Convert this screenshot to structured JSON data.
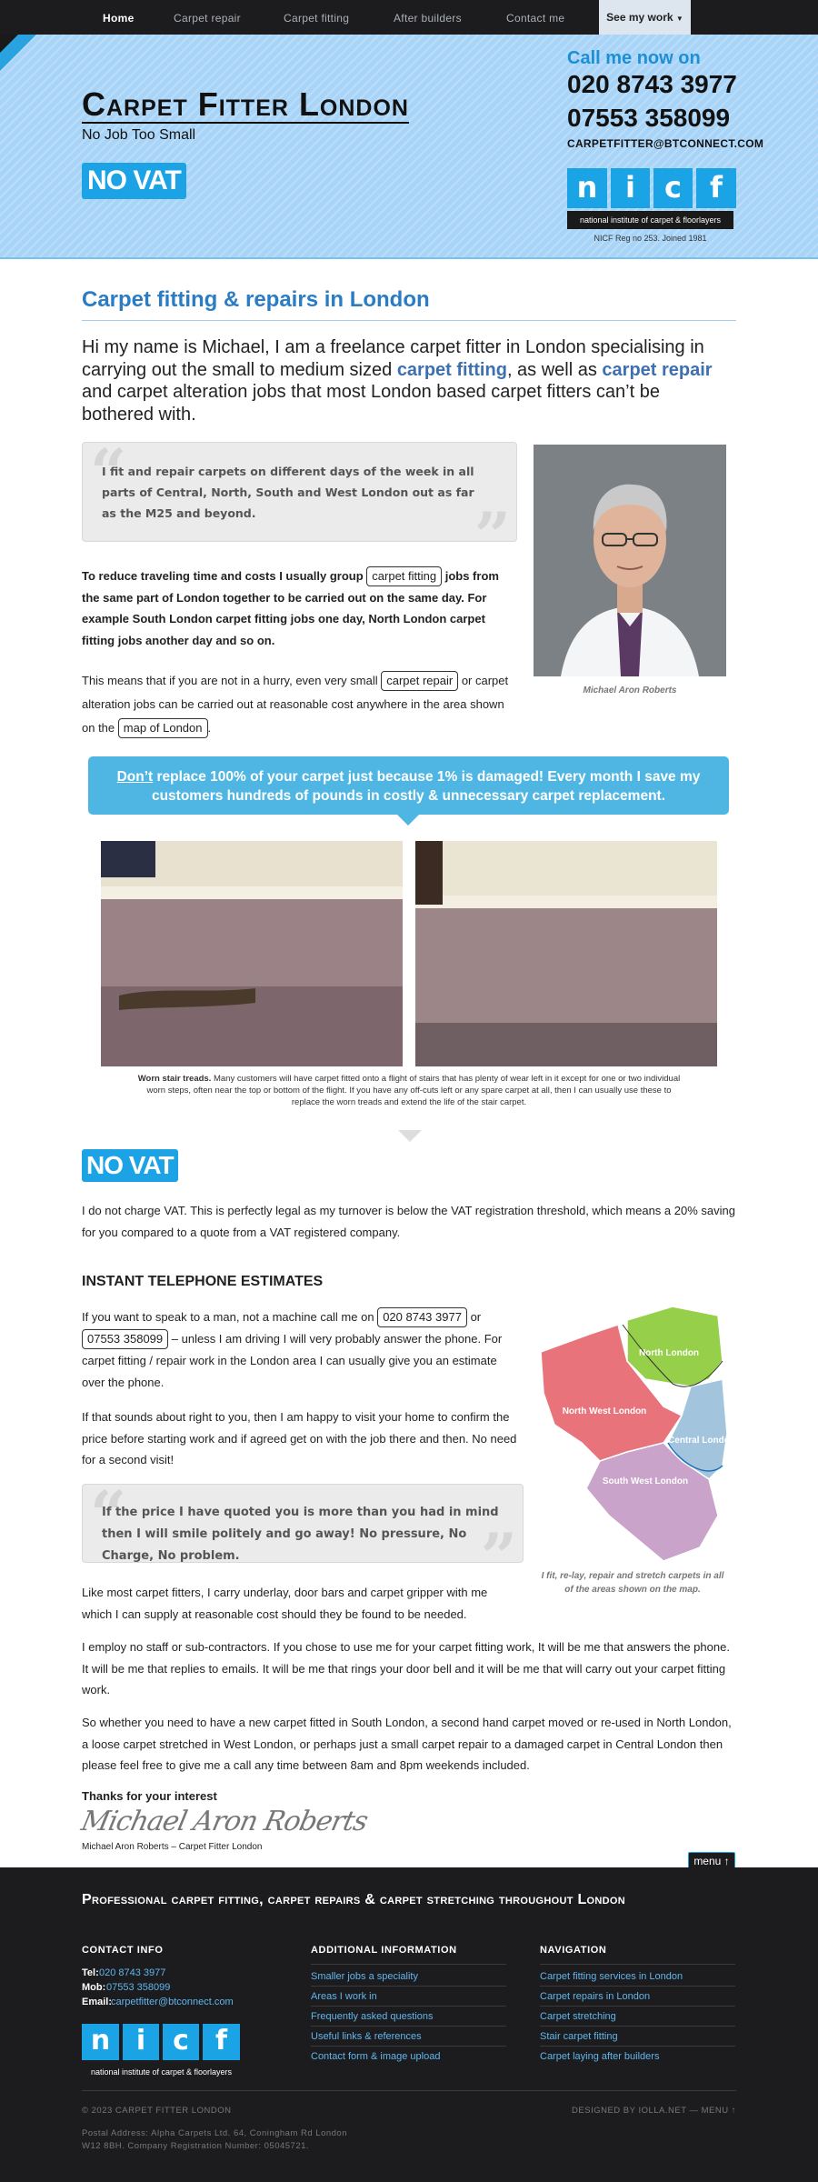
{
  "nav": {
    "items": [
      "Home",
      "Carpet repair",
      "Carpet fitting",
      "After builders",
      "Contact me"
    ],
    "see_work": "See my work"
  },
  "header": {
    "title": "Carpet Fitter London",
    "tagline": "No Job Too Small",
    "novat": "NO VAT",
    "call_now": "Call me now on",
    "phone1": "020 8743 3977",
    "phone2": "07553 358099",
    "email": "CARPETFITTER@BTCONNECT.COM",
    "nicf_letters": [
      "n",
      "i",
      "c",
      "f"
    ],
    "nicf_bar": "national institute of carpet & floorlayers",
    "nicf_reg": "NICF Reg no 253. Joined 1981"
  },
  "main": {
    "heading": "Carpet fitting & repairs in London",
    "intro_1": "Hi my name is Michael, I am a freelance carpet fitter in London specialising in carrying out the small to medium sized ",
    "intro_link1": "carpet fitting",
    "intro_2": ", as well as ",
    "intro_link2": "carpet repair",
    "intro_3": " and carpet alteration jobs that most London based carpet fitters can’t be bothered with.",
    "quote1": "I fit and repair carpets on different days of the week in all parts of Central, North, South and West London out as far as the M25 and beyond.",
    "para1_a": "To reduce traveling time and costs I usually group ",
    "para1_chip": "carpet fitting",
    "para1_b": " jobs from the same part of London together to be carried out on the same day. For example South London carpet fitting jobs one day, North London carpet fitting jobs another day and so on.",
    "para2_a": "This means that if you are not in a hurry, even very small ",
    "para2_chip1": "carpet repair",
    "para2_b": " or carpet alteration jobs can be carried out at reasonable cost anywhere in the area shown on the ",
    "para2_chip2": "map of London",
    "para2_c": ".",
    "portrait_caption": "Michael Aron Roberts",
    "banner_u": "Don’t",
    "banner_rest": " replace 100% of your carpet just because 1% is damaged! Every month I save my customers hundreds of pounds in costly & unnecessary carpet replacement.",
    "photo_caption_bold": "Worn stair treads.",
    "photo_caption": " Many customers will have carpet fitted onto a flight of stairs that has plenty of wear left in it except for one or two individual worn steps, often near the top or bottom of the flight. If you have any off-cuts left or any spare carpet at all, then I can usually use these to replace the worn treads and extend the life of the stair carpet.",
    "novat2": "NO VAT",
    "vat_text": "I do not charge VAT. This is perfectly legal as my turnover is below the VAT registration threshold, which means a 20% saving for you compared to a quote from a VAT registered company.",
    "estimates_heading": "INSTANT TELEPHONE ESTIMATES",
    "est1_a": "If you want to speak to a man, not a machine call me on ",
    "est1_chip1": "020 8743 3977",
    "est1_b": " or ",
    "est1_chip2": "07553 358099",
    "est1_c": " – unless I am driving I will very probably answer the phone. For carpet fitting / repair work in the London area I can usually give you an estimate over the phone.",
    "est2": "If that sounds about right to you, then I am happy to visit your home to confirm the price before starting work and if agreed get on with the job there and then. No need for a second visit!",
    "quote2": "If the price I have quoted you is more than you had in mind then I will smile politely and go away! No pressure, No Charge, No problem.",
    "map_regions": [
      "North London",
      "North West London",
      "Central London",
      "South West London"
    ],
    "map_caption": "I fit, re-lay, repair and stretch carpets in all of the areas shown on the map.",
    "p_underlay": "Like most carpet fitters, I carry underlay, door bars and carpet gripper with me which I can supply at reasonable cost should they be found to be needed.",
    "p_staff": "I employ no staff or sub-contractors. If you chose to use me for your carpet fitting work, It will be me that answers the phone. It will be me that replies to emails. It will be me that rings your door bell and it will be me that will carry out your carpet fitting work.",
    "p_whether": "So whether you need to have a new carpet fitted in South London, a second hand carpet moved or re-used in North London, a loose carpet stretched in West London, or perhaps just a small carpet repair to a damaged carpet in Central London then please feel free to give me a call any time between 8am and 8pm weekends included.",
    "thanks": "Thanks for your interest",
    "signature": "Michael Aron Roberts",
    "sig_caption": "Michael Aron Roberts – Carpet Fitter London"
  },
  "footer": {
    "menu_tab": "menu ↑",
    "title": "Professional carpet fitting, carpet repairs & carpet stretching throughout London",
    "contact_heading": "CONTACT INFO",
    "tel_label": "Tel:",
    "tel": "020 8743 3977",
    "mob_label": "Mob:",
    "mob": "07553 358099",
    "email_label": "Email:",
    "email": "carpetfitter@btconnect.com",
    "nicf_bar": "national institute of carpet & floorlayers",
    "additional_heading": "ADDITIONAL INFORMATION",
    "additional": [
      "Smaller jobs a speciality",
      "Areas I work in",
      "Frequently asked questions",
      "Useful links & references",
      "Contact form & image upload"
    ],
    "navigation_heading": "NAVIGATION",
    "navigation": [
      "Carpet fitting services in London",
      "Carpet repairs in London",
      "Carpet stretching",
      "Stair carpet fitting",
      "Carpet laying after builders"
    ],
    "copyright": "© 2023 CARPET FITTER LONDON",
    "designed": "DESIGNED BY IOLLA.NET — MENU ↑",
    "address1": "Postal Address: Alpha Carpets Ltd. 64, Coningham Rd London",
    "address2": "W12 8BH. Company Registration Number: 05045721."
  },
  "colors": {
    "accent": "#1ca3e6",
    "heading_blue": "#2a7cc4",
    "header_bg": "#a8d4f7",
    "footer_bg": "#1c1c1e",
    "link": "#5eb6f0"
  }
}
